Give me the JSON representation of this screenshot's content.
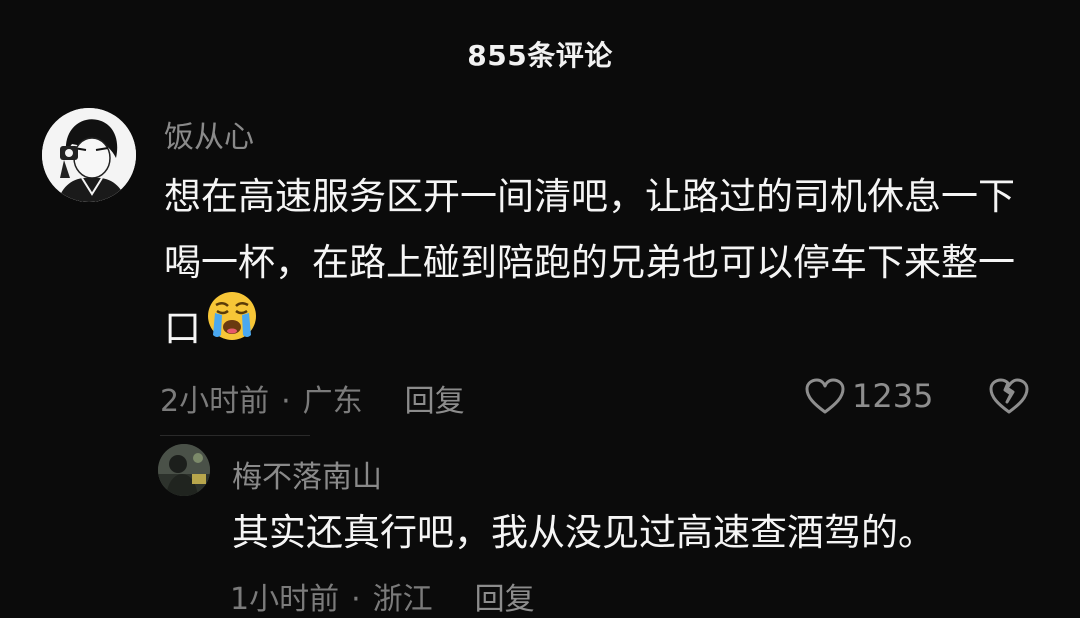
{
  "header": {
    "title": "855条评论"
  },
  "comment": {
    "username": "饭从心",
    "text": "想在高速服务区开一间清吧，让路过的司机休息一下喝一杯，在路上碰到陪跑的兄弟也可以停车下来整一口",
    "emoji": "loudly-crying-face",
    "time": "2小时前",
    "separator": "·",
    "location": "广东",
    "reply_label": "回复",
    "likes": "1235"
  },
  "reply": {
    "username": "梅不落南山",
    "text": "其实还真行吧，我从没见过高速查酒驾的。",
    "time": "1小时前",
    "separator": "·",
    "location": "浙江",
    "reply_label": "回复"
  },
  "colors": {
    "background": "#0b0b0b",
    "primary_text": "#f5f5f5",
    "secondary_text": "#8a8a8a"
  }
}
